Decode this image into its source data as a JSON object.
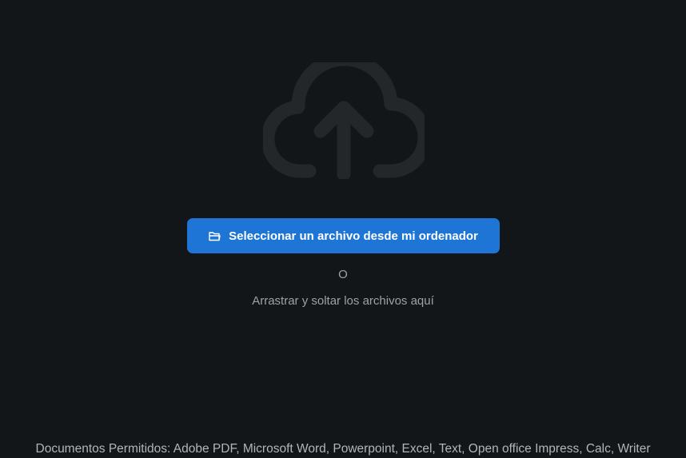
{
  "upload": {
    "icon": "cloud-upload-icon",
    "button_icon": "folder-icon",
    "button_label": "Seleccionar un archivo desde mi ordenador",
    "or_label": "O",
    "drag_hint": "Arrastrar y soltar los archivos aquí",
    "allowed_formats": "Documentos Permitidos: Adobe PDF, Microsoft Word, Powerpoint, Excel, Text, Open office Impress, Calc, Writer"
  },
  "colors": {
    "background": "#131618",
    "accent": "#1e75d6",
    "icon_muted": "#23272a",
    "text_muted": "#9ea2a6"
  }
}
